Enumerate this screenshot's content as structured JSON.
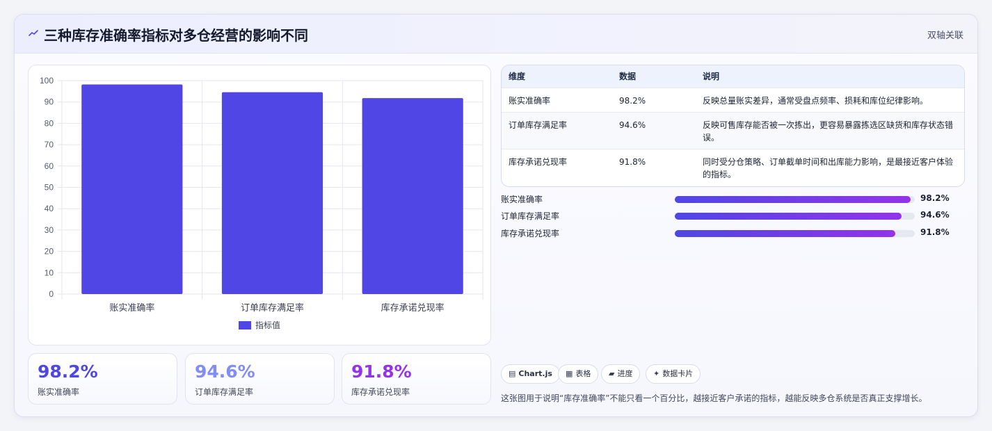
{
  "header": {
    "title": "三种库存准确率指标对多仓经营的影响不同",
    "tag": "双轴关联"
  },
  "chart_data": {
    "type": "bar",
    "categories": [
      "账实准确率",
      "订单库存满足率",
      "库存承诺兑现率"
    ],
    "series": [
      {
        "name": "指标值",
        "values": [
          98.2,
          94.6,
          91.8
        ]
      }
    ],
    "ylim": [
      0,
      100
    ],
    "yticks": [
      0,
      10,
      20,
      30,
      40,
      50,
      60,
      70,
      80,
      90,
      100
    ],
    "grid": true,
    "legend": "bottom",
    "color": "#4f46e5"
  },
  "stats": [
    {
      "value": "98.2%",
      "label": "账实准确率",
      "color": "#4f46e5"
    },
    {
      "value": "94.6%",
      "label": "订单库存满足率",
      "color": "#818cf8"
    },
    {
      "value": "91.8%",
      "label": "库存承诺兑现率",
      "color": "#9333ea"
    }
  ],
  "table": {
    "headers": [
      "维度",
      "数据",
      "说明"
    ],
    "rows": [
      [
        "账实准确率",
        "98.2%",
        "反映总量账实差异，通常受盘点频率、损耗和库位纪律影响。"
      ],
      [
        "订单库存满足率",
        "94.6%",
        "反映可售库存能否被一次拣出，更容易暴露拣选区缺货和库存状态错误。"
      ],
      [
        "库存承诺兑现率",
        "91.8%",
        "同时受分仓策略、订单截单时间和出库能力影响，是最接近客户体验的指标。"
      ]
    ]
  },
  "progress": [
    {
      "label": "账实准确率",
      "value": 98.2,
      "text": "98.2%"
    },
    {
      "label": "订单库存满足率",
      "value": 94.6,
      "text": "94.6%"
    },
    {
      "label": "库存承诺兑现率",
      "value": 91.8,
      "text": "91.8%"
    }
  ],
  "pills": [
    {
      "icon": "▤",
      "label": "Chart.js",
      "bold": true
    },
    {
      "icon": "▦",
      "label": "表格"
    },
    {
      "icon": "▰",
      "label": "进度"
    },
    {
      "icon": "✦",
      "label": "数据卡片"
    }
  ],
  "note": "这张图用于说明“库存准确率”不能只看一个百分比，越接近客户承诺的指标，越能反映多仓系统是否真正支撑增长。"
}
